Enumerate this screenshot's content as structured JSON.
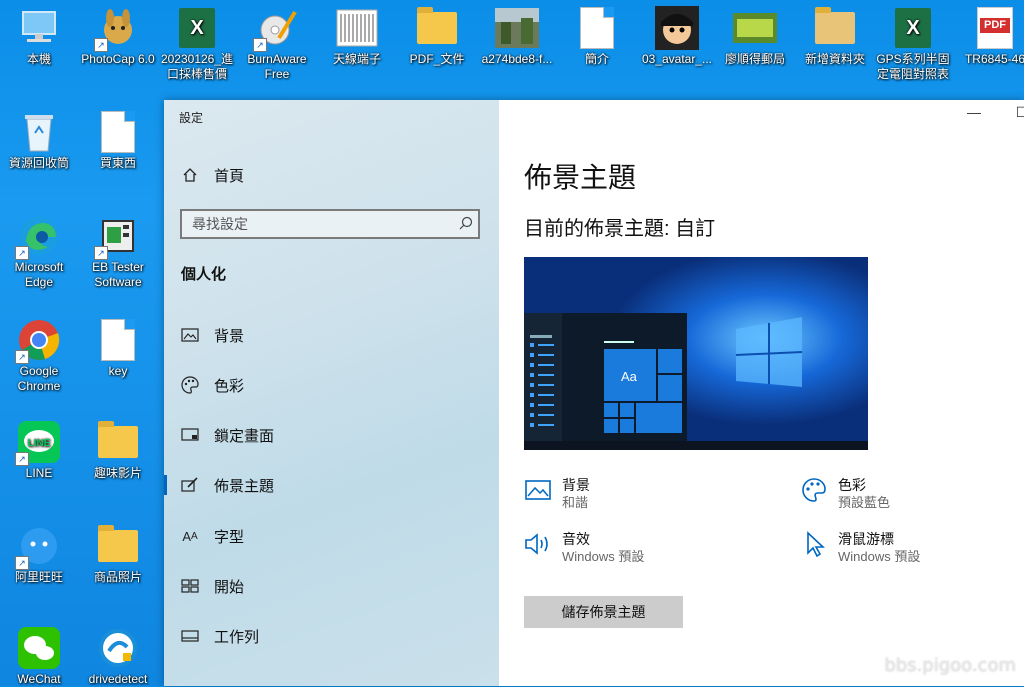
{
  "desktop": {
    "icons": [
      {
        "label": "本機",
        "icon": "computer-icon"
      },
      {
        "label": "PhotoCap 6.0",
        "icon": "photocap-icon"
      },
      {
        "label": "20230126_進口採棒售價",
        "icon": "excel-icon"
      },
      {
        "label": "BurnAware Free",
        "icon": "burnaware-icon"
      },
      {
        "label": "天線端子",
        "icon": "image-file-icon"
      },
      {
        "label": "PDF_文件",
        "icon": "folder-icon"
      },
      {
        "label": "a274bde8-f...",
        "icon": "photo-file-icon"
      },
      {
        "label": "簡介",
        "icon": "document-icon"
      },
      {
        "label": "03_avatar_...",
        "icon": "avatar-icon"
      },
      {
        "label": "廖順得郵局",
        "icon": "image-file-icon"
      },
      {
        "label": "新增資料夾",
        "icon": "folder-icon"
      },
      {
        "label": "GPS系列半固定電阻對照表",
        "icon": "excel-icon"
      },
      {
        "label": "TR6845-46",
        "icon": "pdf-icon"
      },
      {
        "label": "資源回收筒",
        "icon": "recycle-bin-icon"
      },
      {
        "label": "買東西",
        "icon": "document-icon"
      },
      {
        "label": "Microsoft Edge",
        "icon": "edge-icon"
      },
      {
        "label": "EB Tester Software",
        "icon": "eb-tester-icon"
      },
      {
        "label": "Google Chrome",
        "icon": "chrome-icon"
      },
      {
        "label": "key",
        "icon": "document-icon"
      },
      {
        "label": "LINE",
        "icon": "line-icon"
      },
      {
        "label": "趣味影片",
        "icon": "folder-icon"
      },
      {
        "label": "阿里旺旺",
        "icon": "aliwangwang-icon"
      },
      {
        "label": "商品照片",
        "icon": "folder-icon"
      },
      {
        "label": "WeChat",
        "icon": "wechat-icon"
      },
      {
        "label": "drivedetect",
        "icon": "drivedetect-icon"
      }
    ],
    "watermark": "bbs.pigoo.com"
  },
  "settings": {
    "window_title": "設定",
    "controls": {
      "minimize": "—",
      "maximize": "☐"
    },
    "nav_home": "首頁",
    "search_placeholder": "尋找設定",
    "section_header": "個人化",
    "nav_items": [
      {
        "label": "背景",
        "icon": "picture-icon"
      },
      {
        "label": "色彩",
        "icon": "palette-icon"
      },
      {
        "label": "鎖定畫面",
        "icon": "lock-screen-icon"
      },
      {
        "label": "佈景主題",
        "icon": "brush-icon",
        "active": true
      },
      {
        "label": "字型",
        "icon": "font-icon"
      },
      {
        "label": "開始",
        "icon": "start-icon"
      },
      {
        "label": "工作列",
        "icon": "taskbar-icon"
      }
    ],
    "page_title": "佈景主題",
    "current_theme": "目前的佈景主題: 自訂",
    "preview_tile_text": "Aa",
    "properties": [
      {
        "name": "背景",
        "value": "和諧",
        "icon": "picture-icon"
      },
      {
        "name": "色彩",
        "value": "預設藍色",
        "icon": "palette-icon"
      },
      {
        "name": "音效",
        "value": "Windows 預設",
        "icon": "speaker-icon"
      },
      {
        "name": "滑鼠游標",
        "value": "Windows 預設",
        "icon": "cursor-icon"
      }
    ],
    "save_button": "儲存佈景主題"
  },
  "colors": {
    "accent": "#0067c0",
    "desktop": "#1a9af0"
  }
}
